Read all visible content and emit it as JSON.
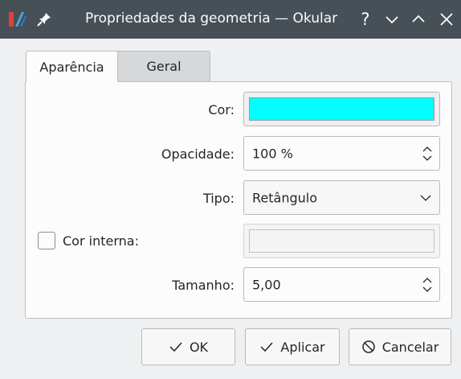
{
  "window": {
    "title": "Propriedades da geometria — Okular",
    "buttons": [
      "help",
      "minimize",
      "maximize",
      "close"
    ],
    "help_glyph": "?"
  },
  "tabs": [
    {
      "label": "Aparência",
      "active": true
    },
    {
      "label": "Geral",
      "active": false
    }
  ],
  "form": {
    "color_label": "Cor:",
    "color_value": "#00ffff",
    "opacity_label": "Opacidade:",
    "opacity_value": "100 %",
    "type_label": "Tipo:",
    "type_value": "Retângulo",
    "inner_color_label": "Cor interna:",
    "inner_color_checked": false,
    "inner_color_value": "#eff0f1",
    "size_label": "Tamanho:",
    "size_value": "5,00"
  },
  "buttons": {
    "ok": "OK",
    "apply": "Aplicar",
    "cancel": "Cancelar"
  },
  "colors": {
    "titlebar": "#475057",
    "accent": "#00ffff"
  }
}
